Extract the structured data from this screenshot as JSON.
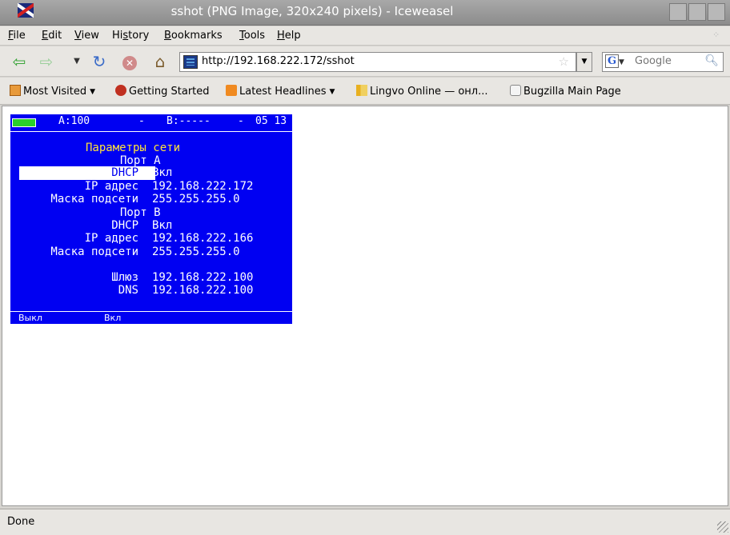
{
  "window": {
    "title": "sshot (PNG Image, 320x240 pixels) - Iceweasel"
  },
  "menu": [
    {
      "label": "File",
      "u": "F",
      "rest": "ile"
    },
    {
      "label": "Edit",
      "u": "E",
      "rest": "dit"
    },
    {
      "label": "View",
      "u": "V",
      "rest": "iew"
    },
    {
      "label": "History",
      "pre": "Hi",
      "u": "s",
      "rest": "tory"
    },
    {
      "label": "Bookmarks",
      "u": "B",
      "rest": "ookmarks"
    },
    {
      "label": "Tools",
      "u": "T",
      "rest": "ools"
    },
    {
      "label": "Help",
      "u": "H",
      "rest": "elp"
    }
  ],
  "nav": {
    "url": "http://192.168.222.172/sshot",
    "search_placeholder": "Google"
  },
  "bookmarks": [
    {
      "label": "Most Visited",
      "icon": "folder-icon",
      "dropdown": true
    },
    {
      "label": "Getting Started",
      "icon": "firefox-icon",
      "dropdown": false
    },
    {
      "label": "Latest Headlines",
      "icon": "rss-icon",
      "dropdown": true
    },
    {
      "label": "Lingvo Online — онл...",
      "icon": "lingvo-icon",
      "dropdown": false
    },
    {
      "label": "Bugzilla Main Page",
      "icon": "page-icon",
      "dropdown": false
    }
  ],
  "device": {
    "status": {
      "a": "A:100",
      "sep1": "-",
      "b": "B:-----",
      "sep2": "-",
      "time": "05 13"
    },
    "title": "Параметры сети",
    "port_a": {
      "heading": "Порт A",
      "dhcp_label": "DHCP",
      "dhcp_value": "Вкл",
      "ip_label": "IP адрес",
      "ip_value": "192.168.222.172",
      "mask_label": "Маска подсети",
      "mask_value": "255.255.255.0"
    },
    "port_b": {
      "heading": "Порт B",
      "dhcp_label": "DHCP",
      "dhcp_value": "Вкл",
      "ip_label": "IP адрес",
      "ip_value": "192.168.222.166",
      "mask_label": "Маска подсети",
      "mask_value": "255.255.255.0"
    },
    "gateway_label": "Шлюз",
    "gateway_value": "192.168.222.100",
    "dns_label": "DNS",
    "dns_value": "192.168.222.100",
    "softkeys": {
      "f1": "Выкл",
      "f2": "Вкл"
    },
    "colors": {
      "background": "#0000f2",
      "title": "#ffe33a",
      "battery": "#2ad02a"
    }
  },
  "status": {
    "text": "Done"
  }
}
